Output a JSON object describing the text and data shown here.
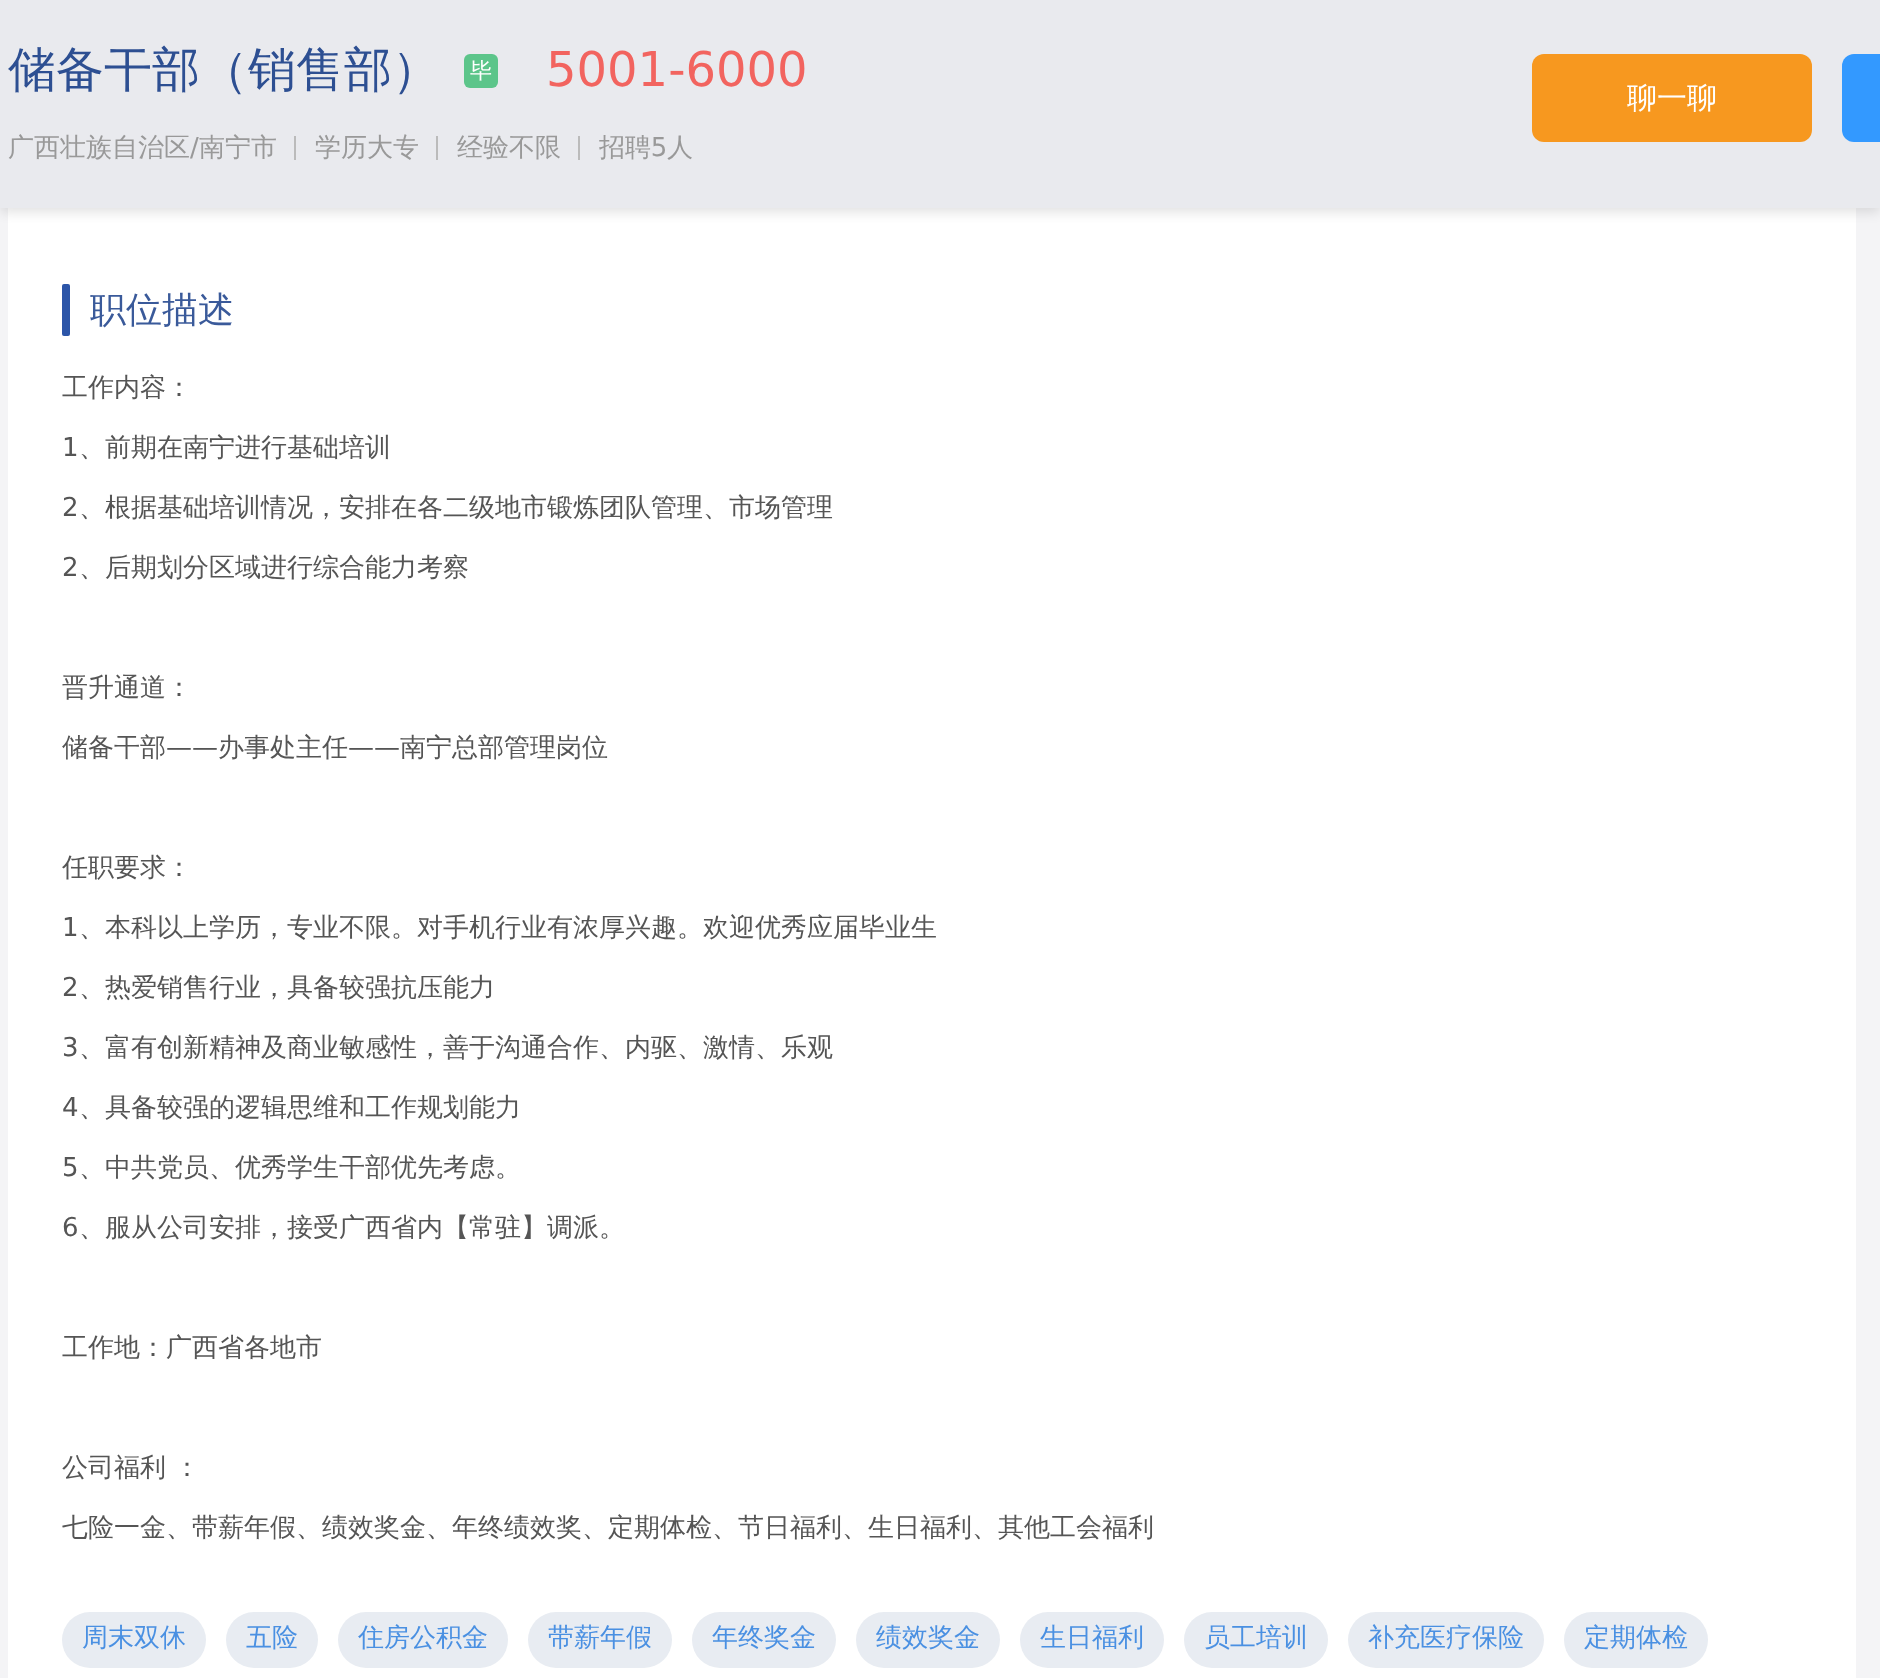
{
  "header": {
    "title": "储备干部（销售部）",
    "badge": "毕",
    "salary": "5001-6000",
    "meta": [
      "广西壮族自治区/南宁市",
      "学历大专",
      "经验不限",
      "招聘5人"
    ],
    "buttons": [
      {
        "kind": "chat",
        "label": "聊一聊"
      },
      {
        "kind": "apply"
      }
    ]
  },
  "description": {
    "title": "职位描述",
    "sections": [
      {
        "lines": [
          "工作内容：",
          "1、前期在南宁进行基础培训",
          "2、根据基础培训情况，安排在各二级地市锻炼团队管理、市场管理",
          "2、后期划分区域进行综合能力考察"
        ]
      },
      {
        "lines": [
          "晋升通道：",
          "储备干部——办事处主任——南宁总部管理岗位"
        ]
      },
      {
        "lines": [
          "任职要求：",
          "1、本科以上学历，专业不限。对手机行业有浓厚兴趣。欢迎优秀应届毕业生",
          "2、热爱销售行业，具备较强抗压能力",
          "3、富有创新精神及商业敏感性，善于沟通合作、内驱、激情、乐观",
          "4、具备较强的逻辑思维和工作规划能力",
          "5、中共党员、优秀学生干部优先考虑。",
          "6、服从公司安排，接受广西省内【常驻】调派。"
        ]
      },
      {
        "lines": [
          "工作地：广西省各地市"
        ]
      },
      {
        "lines": [
          "公司福利 ：",
          "七险一金、带薪年假、绩效奖金、年终绩效奖、定期体检、节日福利、生日福利、其他工会福利"
        ]
      }
    ],
    "tags": [
      "周末双休",
      "五险",
      "住房公积金",
      "带薪年假",
      "年终奖金",
      "绩效奖金",
      "生日福利",
      "员工培训",
      "补充医疗保险",
      "定期体检"
    ]
  }
}
